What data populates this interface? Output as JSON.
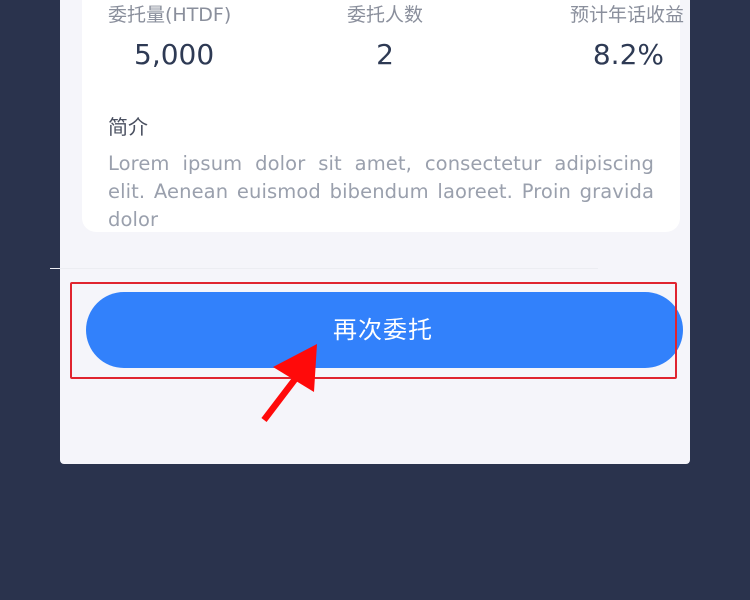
{
  "stats": [
    {
      "label": "委托量(HTDF)",
      "value": "5,000"
    },
    {
      "label": "委托人数",
      "value": "2"
    },
    {
      "label": "预计年话收益",
      "value": "8.2%"
    }
  ],
  "intro": {
    "title": "简介",
    "text": "Lorem ipsum dolor sit amet, consectetur adipiscing elit. Aenean euismod bibendum laoreet. Proin gravida dolor"
  },
  "actions": {
    "delegate_again_label": "再次委托"
  },
  "colors": {
    "background": "#2a334d",
    "panel": "#f5f5fa",
    "card": "#ffffff",
    "accent": "#3281fb",
    "highlight": "#e0242f",
    "annotation_arrow": "#ff0a0a"
  },
  "icons": {
    "annotation": "red-arrow-icon"
  }
}
